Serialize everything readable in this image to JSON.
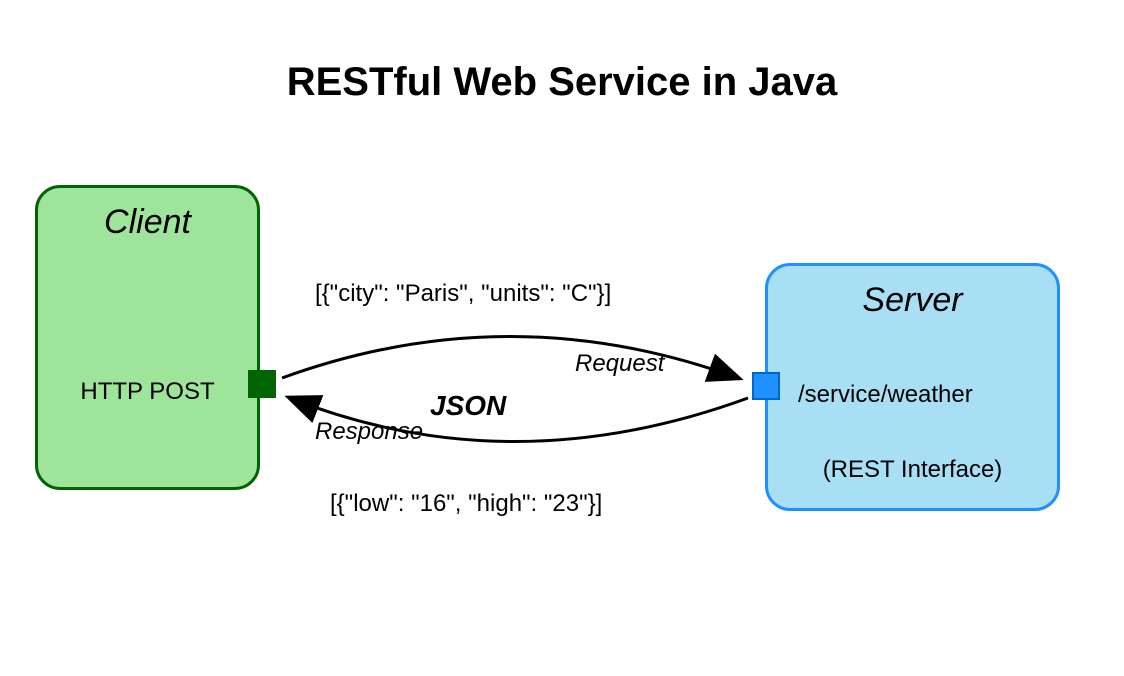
{
  "title": "RESTful Web Service in Java",
  "client": {
    "label": "Client",
    "protocol": "HTTP POST"
  },
  "server": {
    "label": "Server",
    "endpoint": "/service/weather",
    "interface": "(REST Interface)"
  },
  "format_label": "JSON",
  "request": {
    "label": "Request",
    "payload": "[{\"city\": \"Paris\", \"units\": \"C\"}]"
  },
  "response": {
    "label": "Response",
    "payload": "[{\"low\": \"16\", \"high\": \"23\"}]"
  }
}
